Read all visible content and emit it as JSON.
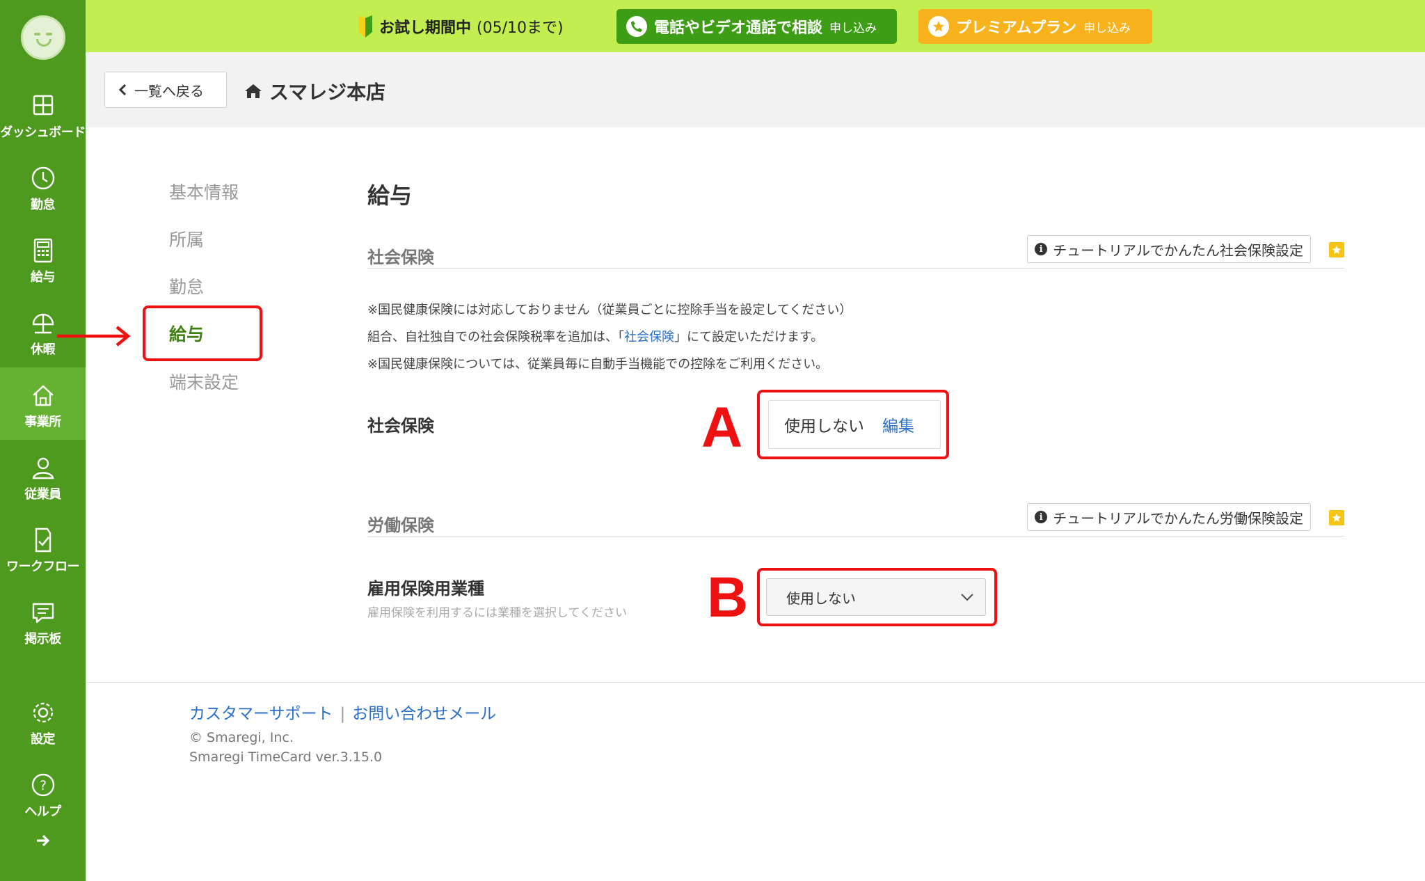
{
  "banner": {
    "trial_label": "お試し期間中",
    "trial_date": "(05/10まで)",
    "phone_label": "電話やビデオ通話で相談",
    "phone_sub": "申し込み",
    "premium_label": "プレミアムプラン",
    "premium_sub": "申し込み"
  },
  "sidebar": {
    "items": [
      {
        "label": "ダッシュボード",
        "icon": "dashboard-icon"
      },
      {
        "label": "勤怠",
        "icon": "clock-icon"
      },
      {
        "label": "給与",
        "icon": "calculator-icon"
      },
      {
        "label": "休暇",
        "icon": "umbrella-icon"
      },
      {
        "label": "事業所",
        "icon": "home-icon",
        "active": true
      },
      {
        "label": "従業員",
        "icon": "user-icon"
      },
      {
        "label": "ワークフロー",
        "icon": "workflow-icon"
      },
      {
        "label": "掲示板",
        "icon": "chat-icon"
      },
      {
        "label": "設定",
        "icon": "gear-icon"
      },
      {
        "label": "ヘルプ",
        "icon": "help-icon"
      }
    ]
  },
  "header": {
    "back_label": "一覧へ戻る",
    "store_name": "スマレジ本店"
  },
  "subnav": {
    "items": [
      "基本情報",
      "所属",
      "勤怠",
      "給与",
      "端末設定"
    ],
    "active": "給与"
  },
  "main": {
    "title": "給与",
    "social": {
      "heading": "社会保険",
      "tutorial_label": "チュートリアルでかんたん社会保険設定",
      "note1": "※国民健康保険には対応しておりません（従業員ごとに控除手当を設定してください）",
      "note2_pre": "組合、自社独自での社会保険税率を追加は、「",
      "note2_link": "社会保険",
      "note2_post": "」にて設定いただけます。",
      "note3": "※国民健康保険については、従業員毎に自動手当機能での控除をご利用ください。",
      "field_label": "社会保険",
      "value": "使用しない",
      "edit_label": "編集"
    },
    "labor": {
      "heading": "労働保険",
      "tutorial_label": "チュートリアルでかんたん労働保険設定",
      "field_label": "雇用保険用業種",
      "field_help": "雇用保険を利用するには業種を選択してください",
      "selected": "使用しない"
    }
  },
  "annotations": {
    "a": "A",
    "b": "B"
  },
  "footer": {
    "support_label": "カスタマーサポート",
    "sep": "|",
    "mail_label": "お問い合わせメール",
    "copyright": "© Smaregi, Inc.",
    "version": "Smaregi TimeCard ver.3.15.0"
  },
  "colors": {
    "sidebar": "#4e9a1e",
    "banner": "#c2ee50",
    "accent_red": "#ee1111",
    "link": "#2a6fc9"
  }
}
